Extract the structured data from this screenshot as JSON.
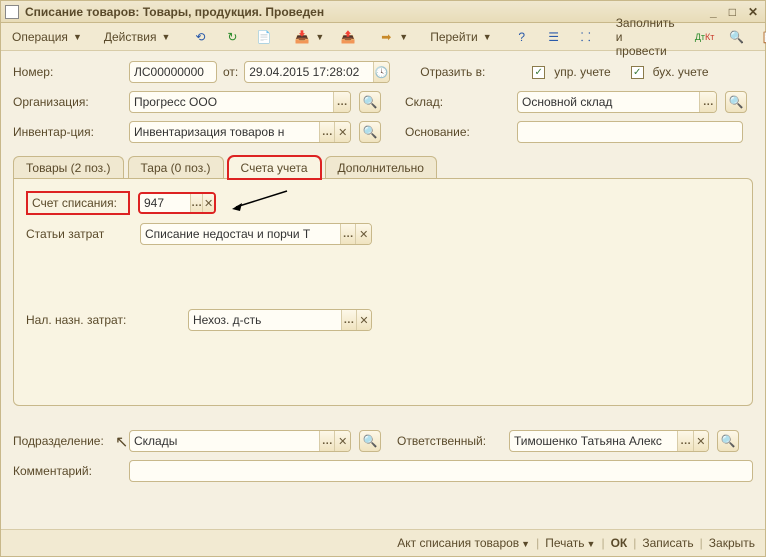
{
  "title": "Списание товаров: Товары, продукция. Проведен",
  "toolbar": {
    "operation": "Операция",
    "actions": "Действия",
    "go": "Перейти",
    "fill_post": "Заполнить и провести"
  },
  "header": {
    "number_label": "Номер:",
    "number_value": "ЛС00000000",
    "date_label": "от:",
    "date_value": "29.04.2015 17:28:02",
    "org_label": "Организация:",
    "org_value": "Прогресс ООО",
    "inventory_label": "Инвентар-ция:",
    "inventory_value": "Инвентаризация товаров н",
    "reflect_label": "Отразить в:",
    "chk_upr": "упр. учете",
    "chk_buh": "бух. учете",
    "warehouse_label": "Склад:",
    "warehouse_value": "Основной склад",
    "basis_label": "Основание:",
    "basis_value": ""
  },
  "tabs": {
    "goods": "Товары (2 поз.)",
    "tara": "Тара (0 поз.)",
    "accounts": "Счета учета",
    "extra": "Дополнительно"
  },
  "accounts_tab": {
    "writeoff_account_label": "Счет списания:",
    "writeoff_account_value": "947",
    "cost_items_label": "Статьи затрат",
    "cost_items_value": "Списание недостач и порчи Т",
    "tax_cost_label": "Нал. назн. затрат:",
    "tax_cost_value": "Нехоз. д-сть"
  },
  "footer": {
    "division_label": "Подразделение:",
    "division_value": "Склады",
    "responsible_label": "Ответственный:",
    "responsible_value": "Тимошенко Татьяна Алекс",
    "comment_label": "Комментарий:",
    "comment_value": ""
  },
  "status": {
    "act": "Акт списания товаров",
    "print": "Печать",
    "ok": "ОК",
    "save": "Записать",
    "close": "Закрыть"
  }
}
